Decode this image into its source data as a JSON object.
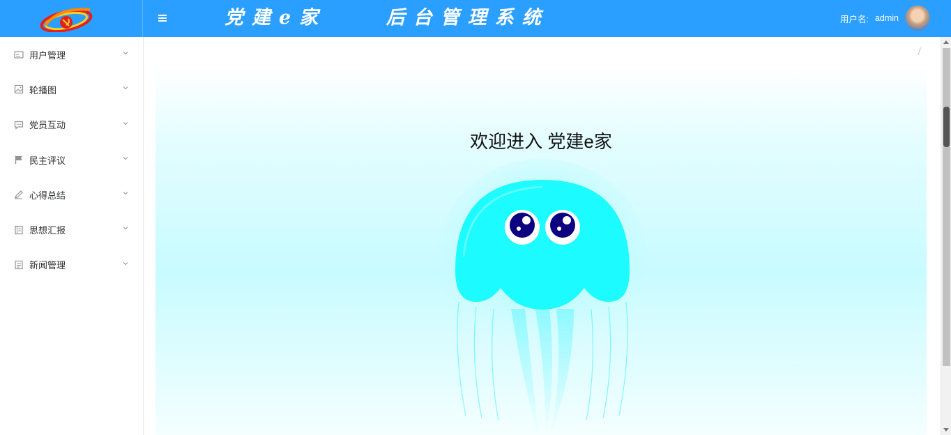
{
  "header": {
    "app_title": "党建e家    后台管理系统",
    "user_label": "用户名:",
    "user_name": "admin",
    "icons": {
      "logo": "party-emblem-logo",
      "menu_toggle": "hamburger-icon",
      "avatar": "user-avatar"
    }
  },
  "sidebar": {
    "items": [
      {
        "label": "用户管理",
        "icon": "id-card-icon"
      },
      {
        "label": "轮播图",
        "icon": "picture-icon"
      },
      {
        "label": "党员互动",
        "icon": "chat-bubble-icon"
      },
      {
        "label": "民主评议",
        "icon": "flag-icon"
      },
      {
        "label": "心得总结",
        "icon": "pen-icon"
      },
      {
        "label": "思想汇报",
        "icon": "notebook-icon"
      },
      {
        "label": "新闻管理",
        "icon": "document-icon"
      }
    ]
  },
  "main": {
    "breadcrumb_separator": "/",
    "welcome_title": "欢迎进入 党建e家"
  },
  "colors": {
    "header_bg": "#2a9fff",
    "jellyfish": "#1cfbff",
    "eye": "#0d0080"
  }
}
